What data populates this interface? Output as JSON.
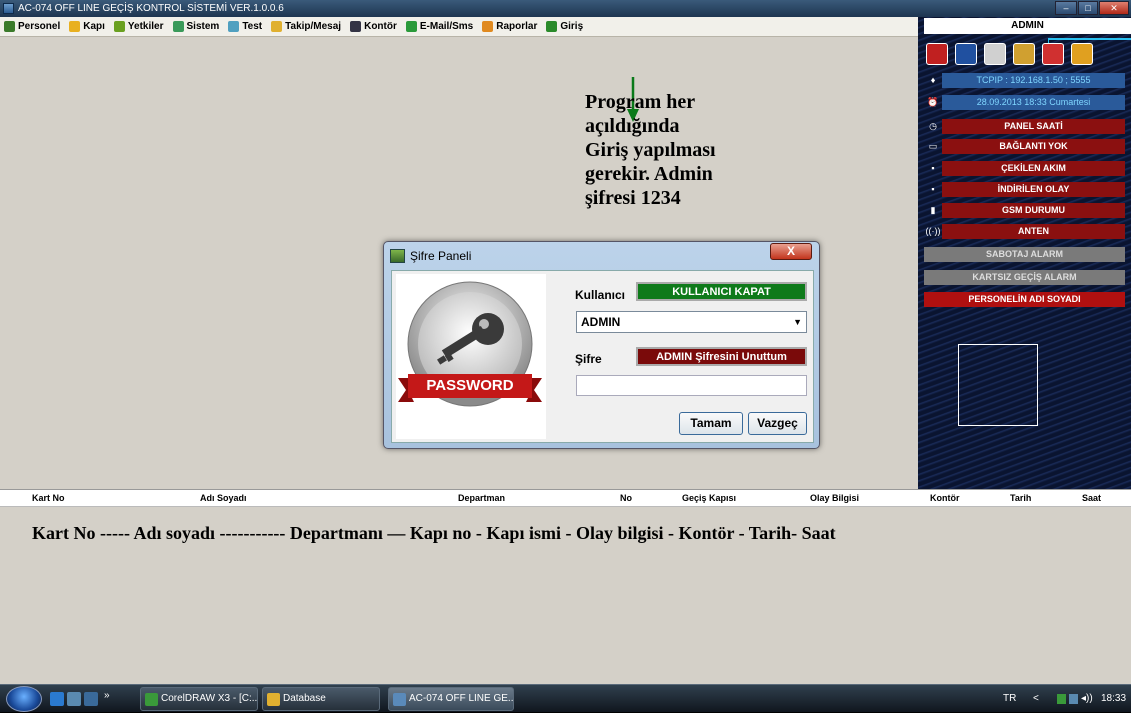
{
  "window": {
    "title": "AC-074 OFF LINE GEÇİŞ KONTROL SİSTEMİ VER.1.0.0.6"
  },
  "menu": [
    {
      "label": "Personel",
      "icon": "people-icon",
      "color": "#3a7a2a"
    },
    {
      "label": "Kapı",
      "icon": "door-icon",
      "color": "#e8b020"
    },
    {
      "label": "Yetkiler",
      "icon": "key-icon",
      "color": "#6aa020"
    },
    {
      "label": "Sistem",
      "icon": "gear-icon",
      "color": "#3a9a5a"
    },
    {
      "label": "Test",
      "icon": "test-icon",
      "color": "#50a0c0"
    },
    {
      "label": "Takip/Mesaj",
      "icon": "message-icon",
      "color": "#e0b030"
    },
    {
      "label": "Kontör",
      "icon": "counter-icon",
      "color": "#334"
    },
    {
      "label": "E-Mail/Sms",
      "icon": "email-icon",
      "color": "#2a9a3a"
    },
    {
      "label": "Raporlar",
      "icon": "report-icon",
      "color": "#e08a20"
    },
    {
      "label": "Giriş",
      "icon": "login-icon",
      "color": "#2a8a2a"
    }
  ],
  "annotation": {
    "lines": [
      "Program her",
      "açıldığında",
      "Giriş yapılması",
      "gerekir. Admin",
      "şifresi 1234"
    ]
  },
  "right_panel": {
    "user": "ADMIN",
    "toolbar_icons": [
      {
        "icon": "alarm-icon",
        "color": "#c02020"
      },
      {
        "icon": "door-icon",
        "color": "#2050a0"
      },
      {
        "icon": "document-icon",
        "color": "#d0d0d0"
      },
      {
        "icon": "folder-icon",
        "color": "#d0a030"
      },
      {
        "icon": "download-icon",
        "color": "#d03030"
      },
      {
        "icon": "refresh-icon",
        "color": "#e0a020"
      }
    ],
    "connection": "TCPIP : 192.168.1.50 ; 5555",
    "datetime": "28.09.2013 18:33 Cumartesi",
    "status": [
      {
        "label": "PANEL SAATİ",
        "icon": "clock-icon"
      },
      {
        "label": "BAĞLANTI YOK",
        "icon": "monitor-icon"
      },
      {
        "label": "ÇEKİLEN AKIM",
        "icon": "power-icon"
      },
      {
        "label": "İNDİRİLEN OLAY",
        "icon": "event-icon"
      },
      {
        "label": "GSM DURUMU",
        "icon": "gsm-icon"
      },
      {
        "label": "ANTEN",
        "icon": "antenna-icon"
      }
    ],
    "alarms": [
      "SABOTAJ ALARM",
      "KARTSIZ GEÇİŞ ALARM"
    ],
    "person_name": "PERSONELİN ADI SOYADI"
  },
  "dialog": {
    "title": "Şifre Paneli",
    "close": "X",
    "image_label": "PASSWORD",
    "user_label": "Kullanıcı",
    "user_button": "KULLANICI KAPAT",
    "selected_user": "ADMIN",
    "password_label": "Şifre",
    "forgot_button": "ADMIN Şifresini Unuttum",
    "password_value": "",
    "ok": "Tamam",
    "cancel": "Vazgeç"
  },
  "table": {
    "columns": [
      "Kart No",
      "Adı Soyadı",
      "Departman",
      "No",
      "Geçiş Kapısı",
      "Olay Bilgisi",
      "Kontör",
      "Tarih",
      "Saat"
    ],
    "description": "Kart No ----- Adı soyadı ----------- Departmanı — Kapı no - Kapı ismi - Olay bilgisi - Kontör - Tarih- Saat"
  },
  "taskbar": {
    "chevron": "»",
    "buttons": [
      {
        "label": "CorelDRAW X3 - [C:...",
        "color": "#3a9a3a"
      },
      {
        "label": "Database",
        "color": "#e0b030"
      },
      {
        "label": "AC-074 OFF LINE GE...",
        "color": "#5a8aba"
      }
    ],
    "lang": "TR",
    "tray_chevron": "<",
    "clock": "18:33"
  }
}
